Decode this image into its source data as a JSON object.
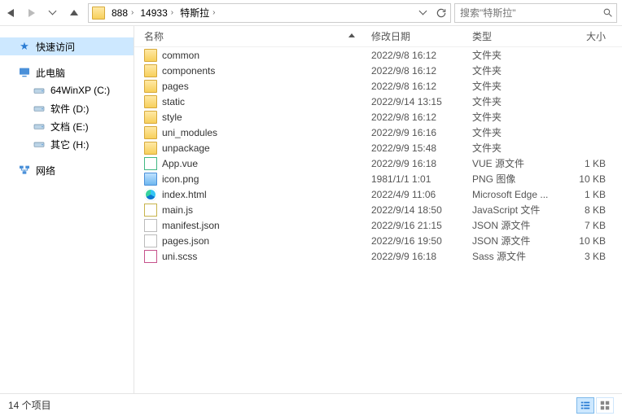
{
  "nav": {
    "breadcrumbs": [
      "888",
      "14933",
      "特斯拉"
    ],
    "search_placeholder": "搜索\"特斯拉\""
  },
  "sidebar": {
    "quick_access": "快速访问",
    "this_pc": "此电脑",
    "drives": [
      {
        "label": "64WinXP  (C:)"
      },
      {
        "label": "软件 (D:)"
      },
      {
        "label": "文档 (E:)"
      },
      {
        "label": "其它 (H:)"
      }
    ],
    "network": "网络"
  },
  "columns": {
    "name": "名称",
    "date": "修改日期",
    "type": "类型",
    "size": "大小"
  },
  "items": [
    {
      "icon": "folder",
      "name": "common",
      "date": "2022/9/8 16:12",
      "type": "文件夹",
      "size": ""
    },
    {
      "icon": "folder",
      "name": "components",
      "date": "2022/9/8 16:12",
      "type": "文件夹",
      "size": ""
    },
    {
      "icon": "folder",
      "name": "pages",
      "date": "2022/9/8 16:12",
      "type": "文件夹",
      "size": ""
    },
    {
      "icon": "folder",
      "name": "static",
      "date": "2022/9/14 13:15",
      "type": "文件夹",
      "size": ""
    },
    {
      "icon": "folder",
      "name": "style",
      "date": "2022/9/8 16:12",
      "type": "文件夹",
      "size": ""
    },
    {
      "icon": "folder",
      "name": "uni_modules",
      "date": "2022/9/9 16:16",
      "type": "文件夹",
      "size": ""
    },
    {
      "icon": "folder",
      "name": "unpackage",
      "date": "2022/9/9 15:48",
      "type": "文件夹",
      "size": ""
    },
    {
      "icon": "vue",
      "name": "App.vue",
      "date": "2022/9/9 16:18",
      "type": "VUE 源文件",
      "size": "1 KB"
    },
    {
      "icon": "img",
      "name": "icon.png",
      "date": "1981/1/1 1:01",
      "type": "PNG 图像",
      "size": "10 KB"
    },
    {
      "icon": "edge",
      "name": "index.html",
      "date": "2022/4/9 11:06",
      "type": "Microsoft Edge ...",
      "size": "1 KB"
    },
    {
      "icon": "js",
      "name": "main.js",
      "date": "2022/9/14 18:50",
      "type": "JavaScript 文件",
      "size": "8 KB"
    },
    {
      "icon": "json",
      "name": "manifest.json",
      "date": "2022/9/16 21:15",
      "type": "JSON 源文件",
      "size": "7 KB"
    },
    {
      "icon": "json",
      "name": "pages.json",
      "date": "2022/9/16 19:50",
      "type": "JSON 源文件",
      "size": "10 KB"
    },
    {
      "icon": "scss",
      "name": "uni.scss",
      "date": "2022/9/9 16:18",
      "type": "Sass 源文件",
      "size": "3 KB"
    }
  ],
  "status": {
    "count_label": "14 个项目"
  }
}
